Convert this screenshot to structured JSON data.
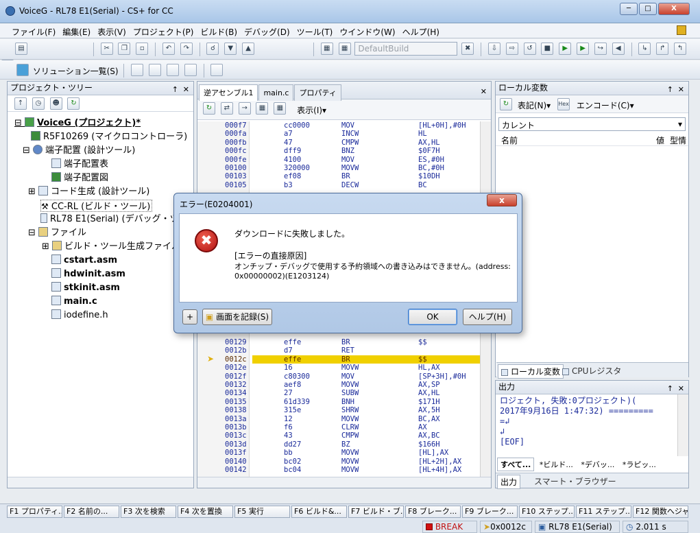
{
  "window": {
    "title": "VoiceG - RL78 E1(Serial) - CS+ for CC",
    "min": "─",
    "max": "□",
    "close": "X"
  },
  "menu": [
    "ファイル(F)",
    "編集(E)",
    "表示(V)",
    "プロジェクト(P)",
    "ビルド(B)",
    "デバッグ(D)",
    "ツール(T)",
    "ウインドウ(W)",
    "ヘルプ(H)"
  ],
  "toolbar": {
    "build_config": "DefaultBuild",
    "solution_list": "ソリューション一覧(S)"
  },
  "project_tree": {
    "title": "プロジェクト・ツリー",
    "pin": "↑",
    "close": "✕",
    "items": [
      {
        "label": "VoiceG (プロジェクト)*"
      },
      {
        "label": "R5F10269 (マイクロコントローラ)"
      },
      {
        "label": "端子配置 (設計ツール)"
      },
      {
        "label": "端子配置表"
      },
      {
        "label": "端子配置図"
      },
      {
        "label": "コード生成 (設計ツール)"
      },
      {
        "label": "CC-RL (ビルド・ツール)"
      },
      {
        "label": "RL78 E1(Serial) (デバッグ・ツー"
      },
      {
        "label": "ファイル"
      },
      {
        "label": "ビルド・ツール生成ファイル"
      },
      {
        "label": "cstart.asm"
      },
      {
        "label": "hdwinit.asm"
      },
      {
        "label": "stkinit.asm"
      },
      {
        "label": "main.c"
      },
      {
        "label": "iodefine.h"
      }
    ]
  },
  "editor": {
    "tabs": [
      "逆アセンブル1",
      "main.c",
      "プロパティ"
    ],
    "view_menu": "表示(I)▾",
    "rows_top": [
      [
        "000f7",
        "cc0000",
        "MOV",
        "[HL+0H],#0H"
      ],
      [
        "000fa",
        "a7",
        "INCW",
        "HL"
      ],
      [
        "000fb",
        "47",
        "CMPW",
        "AX,HL"
      ],
      [
        "000fc",
        "dff9",
        "BNZ",
        "$0F7H"
      ],
      [
        "000fe",
        "4100",
        "MOV",
        "ES,#0H"
      ],
      [
        "00100",
        "320000",
        "MOVW",
        "BC,#0H"
      ],
      [
        "00103",
        "ef08",
        "BR",
        "$10DH"
      ],
      [
        "00105",
        "b3",
        "DECW",
        "BC"
      ]
    ],
    "rows_bottom": [
      [
        "00129",
        "effe",
        "BR",
        "$$"
      ],
      [
        "0012b",
        "d7",
        "RET",
        ""
      ],
      [
        "0012c",
        "effe",
        "BR",
        "$$"
      ],
      [
        "0012e",
        "16",
        "MOVW",
        "HL,AX"
      ],
      [
        "0012f",
        "c80300",
        "MOV",
        "[SP+3H],#0H"
      ],
      [
        "00132",
        "aef8",
        "MOVW",
        "AX,SP"
      ],
      [
        "00134",
        "27",
        "SUBW",
        "AX,HL"
      ],
      [
        "00135",
        "61d339",
        "BNH",
        "$171H"
      ],
      [
        "00138",
        "315e",
        "SHRW",
        "AX,5H"
      ],
      [
        "0013a",
        "12",
        "MOVW",
        "BC,AX"
      ],
      [
        "0013b",
        "f6",
        "CLRW",
        "AX"
      ],
      [
        "0013c",
        "43",
        "CMPW",
        "AX,BC"
      ],
      [
        "0013d",
        "dd27",
        "BZ",
        "$166H"
      ],
      [
        "0013f",
        "bb",
        "MOVW",
        "[HL],AX"
      ],
      [
        "00140",
        "bc02",
        "MOVW",
        "[HL+2H],AX"
      ],
      [
        "00142",
        "bc04",
        "MOVW",
        "[HL+4H],AX"
      ]
    ]
  },
  "locals": {
    "title": "ローカル変数",
    "notation": "表記(N)▾",
    "encode": "エンコード(C)▾",
    "scope": "カレント",
    "col_name": "名前",
    "col_value": "値",
    "col_type": "型情",
    "tab_locals": "ローカル変数",
    "tab_cpu": "CPUレジスタ"
  },
  "output": {
    "title": "出力",
    "lines": [
      "ロジェクト, 失敗:0プロジェクト)(",
      "2017年9月16日 1:47:32) =========",
      "=↲",
      "↲",
      "[EOF]"
    ],
    "tabs": [
      "すべて...",
      "*ビルド...",
      "*デバッ...",
      "*ラピッ..."
    ],
    "bottom_tabs": [
      "出力",
      "スマート・ブラウザー"
    ]
  },
  "dialog": {
    "title": "エラー(E0204001)",
    "line1": "ダウンロードに失敗しました。",
    "line2": "[エラーの直接原因]",
    "line3": "オンチップ・デバッグで使用する予約領域への書き込みはできません。(address:",
    "line4": "0x00000002)(E1203124)",
    "plus": "+",
    "record": "画面を記録(S)",
    "ok": "OK",
    "help": "ヘルプ(H)",
    "close": "x"
  },
  "fkeys": [
    "F1 プロパティ...",
    "F2 名前の...",
    "F3 次を検索",
    "F4 次を置換",
    "F5 実行",
    "F6 ビルド&...",
    "F7 ビルド・ブ...",
    "F8 ブレーク...",
    "F9 ブレーク...",
    "F10 ステップ...",
    "F11 ステップ...",
    "F12 関数へジャ..."
  ],
  "status": {
    "break": "BREAK",
    "pc": "0x0012c",
    "target": "RL78 E1(Serial)",
    "time": "2.011 s"
  }
}
